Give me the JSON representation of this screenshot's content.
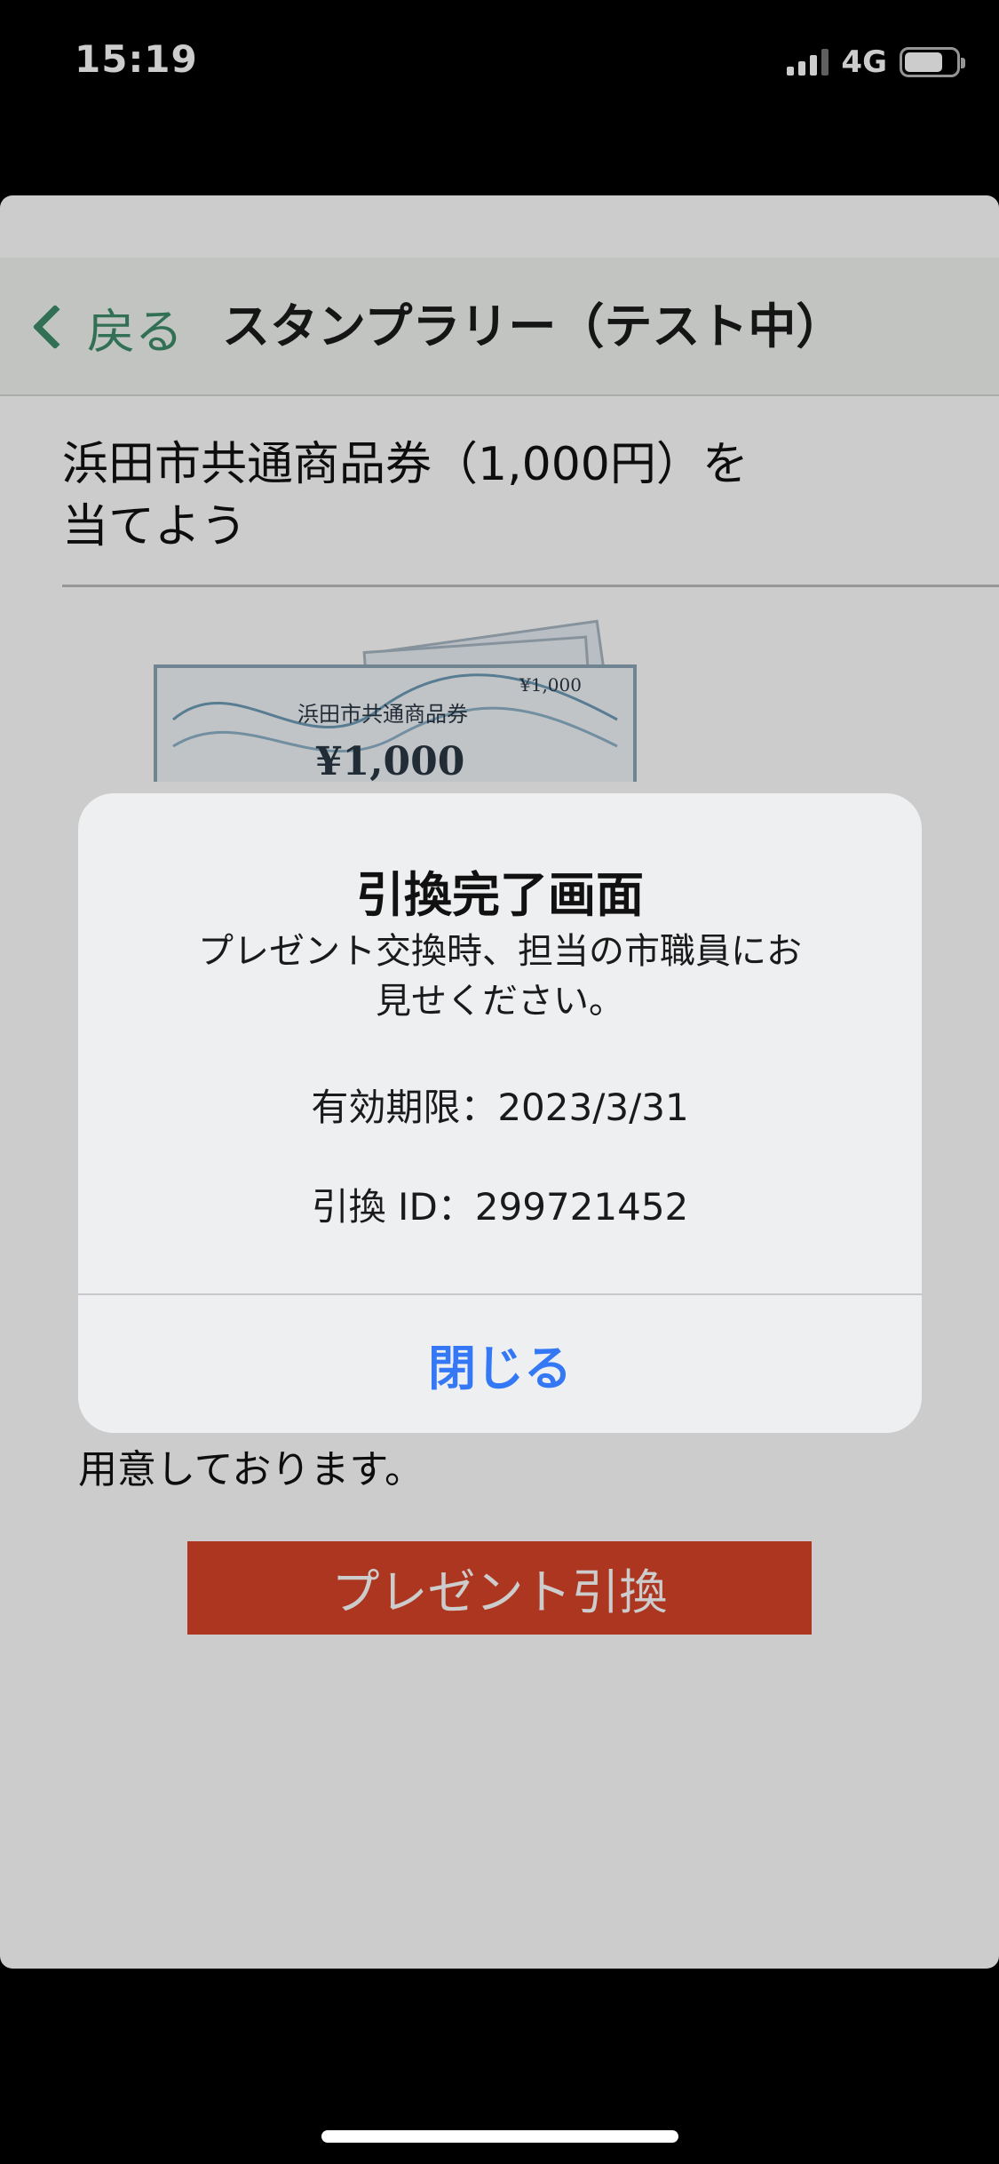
{
  "status_bar": {
    "time": "15:19",
    "network": "4G"
  },
  "navbar": {
    "back_label": "戻る",
    "title": "スタンプラリー（テスト中）"
  },
  "prize": {
    "heading_line1": "浜田市共通商品券（1,000円）を",
    "heading_line2": "当てよう",
    "voucher_text": "浜田市共通商品券",
    "voucher_amount": "¥1,000",
    "voucher_corner": "¥1,000",
    "body_text": "用意しております。"
  },
  "present_button": {
    "label": "プレゼント引換"
  },
  "alert": {
    "title": "引換完了画面",
    "message_line1": "プレゼント交換時、担当の市職員にお",
    "message_line2": "見せください。",
    "expiry": "有効期限：2023/3/31",
    "redeem_id": "引換 ID：299721452",
    "close_label": "閉じる"
  },
  "colors": {
    "accent_green": "#3f8d6b",
    "button_red": "#d84428",
    "alert_blue": "#3478f6"
  }
}
